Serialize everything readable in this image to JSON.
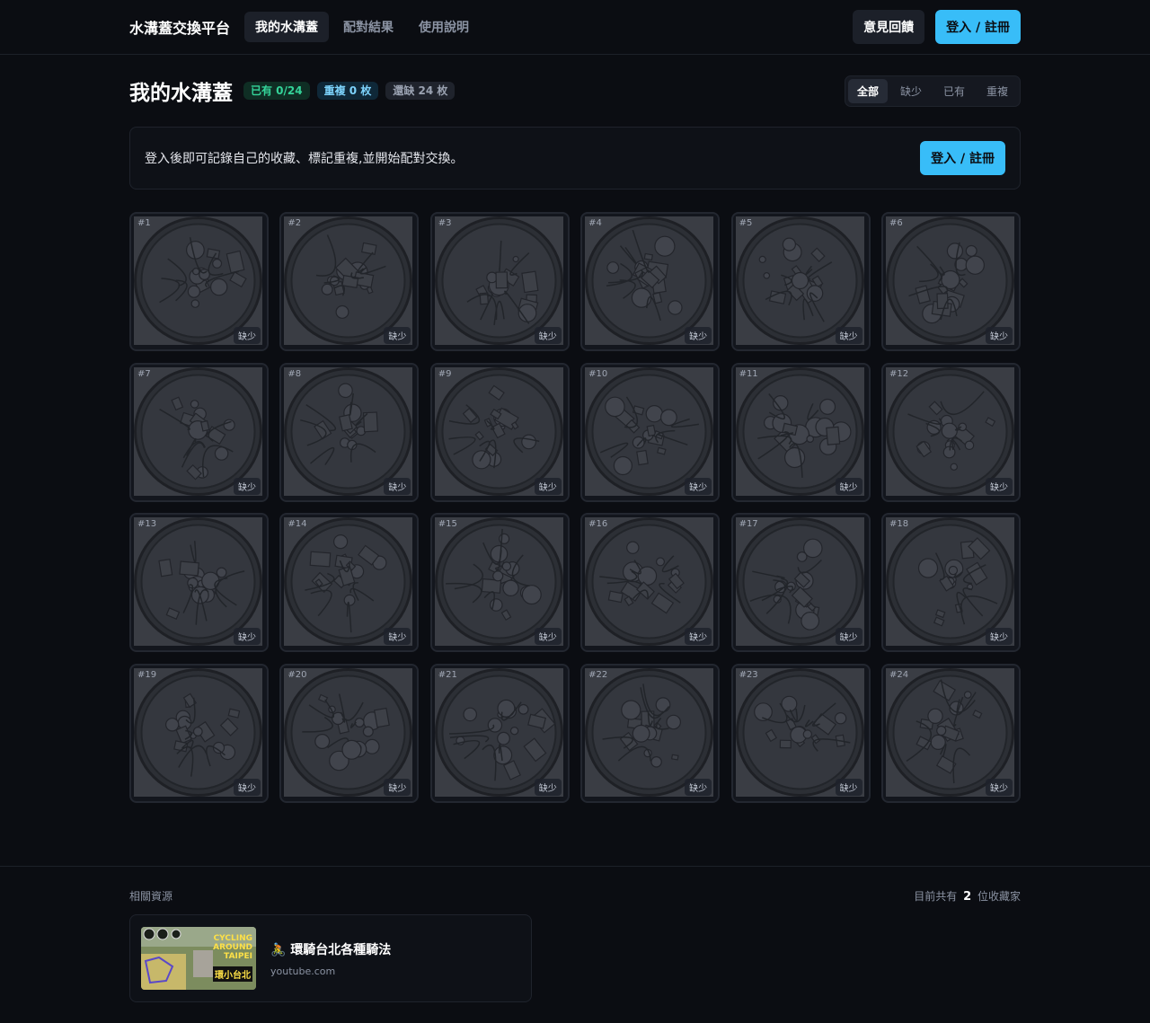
{
  "nav": {
    "brand": "水溝蓋交換平台",
    "links": [
      "我的水溝蓋",
      "配對結果",
      "使用說明"
    ],
    "feedback_label": "意見回饋",
    "login_label": "登入 / 註冊"
  },
  "header": {
    "title": "我的水溝蓋",
    "have_badge": "已有 0/24",
    "dup_badge": "重複 0 枚",
    "miss_badge": "還缺 24 枚",
    "filters": [
      "全部",
      "缺少",
      "已有",
      "重複"
    ]
  },
  "banner": {
    "text": "登入後即可記錄自己的收藏、標記重複,並開始配對交換。",
    "login_label": "登入 / 註冊"
  },
  "covers": [
    {
      "num": "#1",
      "status": "缺少"
    },
    {
      "num": "#2",
      "status": "缺少"
    },
    {
      "num": "#3",
      "status": "缺少"
    },
    {
      "num": "#4",
      "status": "缺少"
    },
    {
      "num": "#5",
      "status": "缺少"
    },
    {
      "num": "#6",
      "status": "缺少"
    },
    {
      "num": "#7",
      "status": "缺少"
    },
    {
      "num": "#8",
      "status": "缺少"
    },
    {
      "num": "#9",
      "status": "缺少"
    },
    {
      "num": "#10",
      "status": "缺少"
    },
    {
      "num": "#11",
      "status": "缺少"
    },
    {
      "num": "#12",
      "status": "缺少"
    },
    {
      "num": "#13",
      "status": "缺少"
    },
    {
      "num": "#14",
      "status": "缺少"
    },
    {
      "num": "#15",
      "status": "缺少"
    },
    {
      "num": "#16",
      "status": "缺少"
    },
    {
      "num": "#17",
      "status": "缺少"
    },
    {
      "num": "#18",
      "status": "缺少"
    },
    {
      "num": "#19",
      "status": "缺少"
    },
    {
      "num": "#20",
      "status": "缺少"
    },
    {
      "num": "#21",
      "status": "缺少"
    },
    {
      "num": "#22",
      "status": "缺少"
    },
    {
      "num": "#23",
      "status": "缺少"
    },
    {
      "num": "#24",
      "status": "缺少"
    }
  ],
  "footer": {
    "label": "相關資源",
    "count_prefix": "目前共有",
    "count": "2",
    "count_suffix": "位收藏家",
    "resource": {
      "icon": "🚴",
      "title": "環騎台北各種騎法",
      "url": "youtube.com",
      "thumb_text_1": "CYCLING",
      "thumb_text_2": "AROUND",
      "thumb_text_3": "TAIPEI",
      "thumb_text_4": "環小台北"
    }
  },
  "colors": {
    "accent": "#38bdf8",
    "background": "#0b0d12",
    "have": "#34d399"
  }
}
